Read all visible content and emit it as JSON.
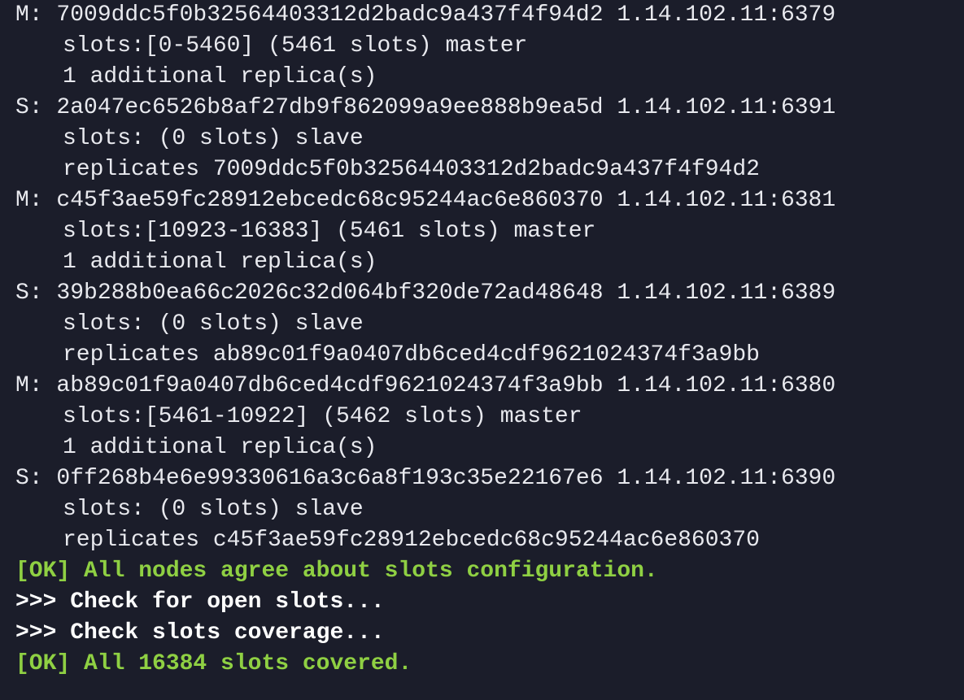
{
  "terminal": {
    "colors": {
      "background": "#1b1d2a",
      "text": "#e8e9ee",
      "ok": "#8fd043",
      "command": "#ffffff"
    },
    "lines": [
      {
        "kind": "node",
        "text": "M: 7009ddc5f0b32564403312d2badc9a437f4f94d2 1.14.102.11:6379"
      },
      {
        "kind": "detail",
        "text": "slots:[0-5460] (5461 slots) master"
      },
      {
        "kind": "detail",
        "text": "1 additional replica(s)"
      },
      {
        "kind": "node",
        "text": "S: 2a047ec6526b8af27db9f862099a9ee888b9ea5d 1.14.102.11:6391"
      },
      {
        "kind": "detail",
        "text": "slots: (0 slots) slave"
      },
      {
        "kind": "detail",
        "text": "replicates 7009ddc5f0b32564403312d2badc9a437f4f94d2"
      },
      {
        "kind": "node",
        "text": "M: c45f3ae59fc28912ebcedc68c95244ac6e860370 1.14.102.11:6381"
      },
      {
        "kind": "detail",
        "text": "slots:[10923-16383] (5461 slots) master"
      },
      {
        "kind": "detail",
        "text": "1 additional replica(s)"
      },
      {
        "kind": "node",
        "text": "S: 39b288b0ea66c2026c32d064bf320de72ad48648 1.14.102.11:6389"
      },
      {
        "kind": "detail",
        "text": "slots: (0 slots) slave"
      },
      {
        "kind": "detail",
        "text": "replicates ab89c01f9a0407db6ced4cdf9621024374f3a9bb"
      },
      {
        "kind": "node",
        "text": "M: ab89c01f9a0407db6ced4cdf9621024374f3a9bb 1.14.102.11:6380"
      },
      {
        "kind": "detail",
        "text": "slots:[5461-10922] (5462 slots) master"
      },
      {
        "kind": "detail",
        "text": "1 additional replica(s)"
      },
      {
        "kind": "node",
        "text": "S: 0ff268b4e6e99330616a3c6a8f193c35e22167e6 1.14.102.11:6390"
      },
      {
        "kind": "detail",
        "text": "slots: (0 slots) slave"
      },
      {
        "kind": "detail",
        "text": "replicates c45f3ae59fc28912ebcedc68c95244ac6e860370"
      },
      {
        "kind": "ok",
        "text": "[OK] All nodes agree about slots configuration."
      },
      {
        "kind": "cmd",
        "text": ">>> Check for open slots..."
      },
      {
        "kind": "cmd",
        "text": ">>> Check slots coverage..."
      },
      {
        "kind": "ok",
        "text": "[OK] All 16384 slots covered."
      }
    ]
  }
}
